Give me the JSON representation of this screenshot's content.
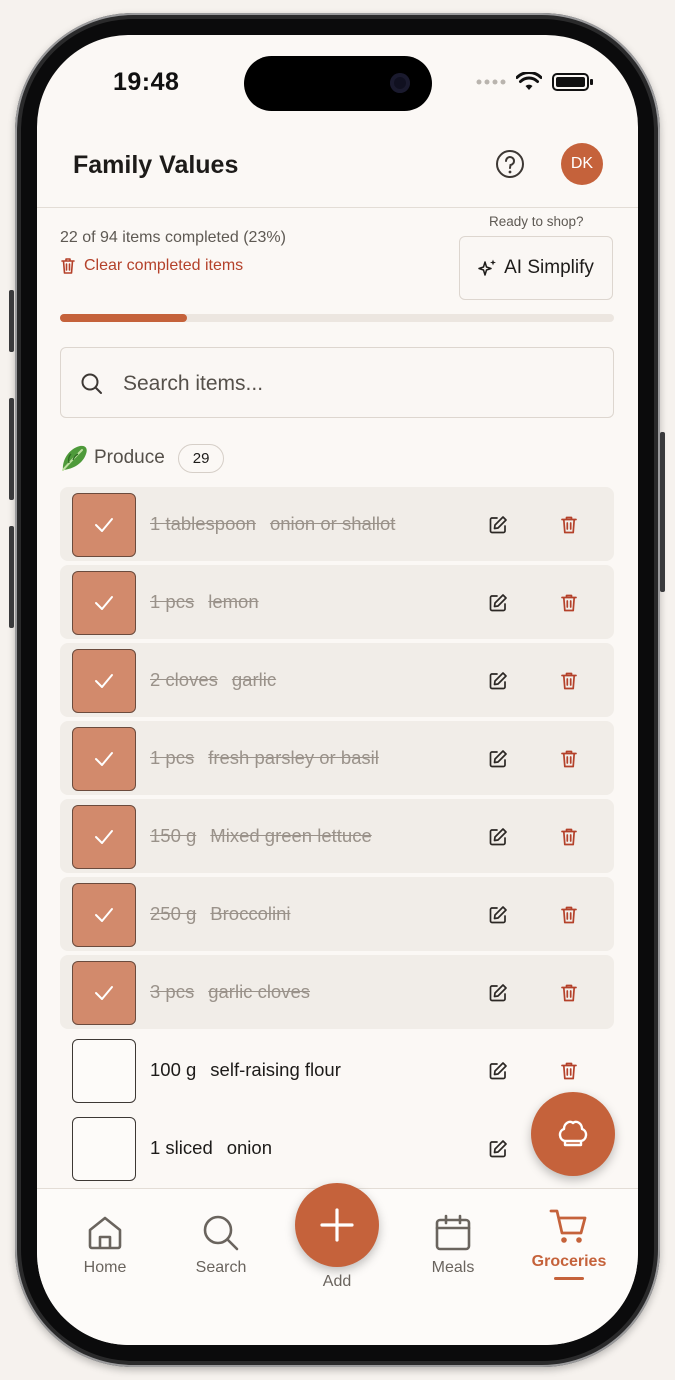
{
  "status": {
    "time": "19:48"
  },
  "header": {
    "title": "Family Values",
    "avatar_initials": "DK",
    "help_icon": "help-circle-icon"
  },
  "progress": {
    "text": "22 of 94 items completed (23%)",
    "percent": 23,
    "clear_label": "Clear completed items",
    "ready_label": "Ready to shop?",
    "simplify_label": "AI Simplify"
  },
  "search": {
    "placeholder": "Search items..."
  },
  "category": {
    "name": "Produce",
    "count": "29",
    "icon": "lettuce-emoji"
  },
  "items": [
    {
      "qty": "1 tablespoon",
      "name": "onion or shallot",
      "done": true
    },
    {
      "qty": "1 pcs",
      "name": "lemon",
      "done": true
    },
    {
      "qty": "2 cloves",
      "name": "garlic",
      "done": true
    },
    {
      "qty": "1 pcs",
      "name": "fresh parsley or basil",
      "done": true
    },
    {
      "qty": "150 g",
      "name": "Mixed green lettuce",
      "done": true
    },
    {
      "qty": "250 g",
      "name": "Broccolini",
      "done": true
    },
    {
      "qty": "3 pcs",
      "name": "garlic cloves",
      "done": true
    },
    {
      "qty": "100 g",
      "name": "self-raising flour",
      "done": false
    },
    {
      "qty": "1 sliced",
      "name": "onion",
      "done": false
    }
  ],
  "nav": {
    "home": "Home",
    "search": "Search",
    "add": "Add",
    "meals": "Meals",
    "groceries": "Groceries",
    "active": "groceries"
  },
  "colors": {
    "accent": "#c5623b",
    "danger": "#b4412a",
    "done_check": "#d28a6c"
  }
}
